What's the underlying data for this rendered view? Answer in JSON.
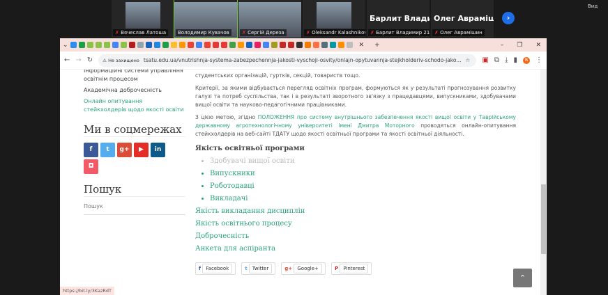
{
  "zoom": {
    "view_label": "Вид",
    "participants": [
      {
        "name": "Вячеслав Латоша",
        "muted": true,
        "video": true
      },
      {
        "name": "Володимир Кувачов",
        "muted": false,
        "video": true,
        "active": true
      },
      {
        "name": "Сергій Дереза",
        "muted": true,
        "video": true
      },
      {
        "name": "Oleksandr Kalashnikov",
        "muted": true,
        "video": true
      },
      {
        "name": "Барлит Владимир 21...",
        "title": "Барлит Владим...",
        "muted": true,
        "video": false
      },
      {
        "name": "Олег Аврамішин",
        "title": "Олег Аврамішин",
        "muted": true,
        "video": false
      }
    ]
  },
  "browser": {
    "tab_favicon_colors": [
      "#2d8cf0",
      "#1e9e4a",
      "#8bc34a",
      "#8bc34a",
      "#8bc34a",
      "#4285f4",
      "#8bc34a",
      "#b71c1c",
      "#90a4ae",
      "#1565c0",
      "#1e88e5",
      "#1e9e4a",
      "#fbc02d",
      "#ff9800",
      "#ea4335",
      "#4285f4",
      "#ea4335",
      "#e53935",
      "#e53935",
      "#43a047",
      "#ff9800",
      "#1565c0",
      "#e91e63",
      "#4285f4",
      "#9e9d24",
      "#c62828",
      "#c62828",
      "#333333",
      "#f57c00",
      "#ff7043",
      "#546e7a",
      "#0097a7",
      "#ff8f00",
      "#bdbdbd"
    ],
    "security_label": "Не захищено",
    "url": "tsatu.edu.ua/vnutrishnja-systema-zabezpechennja-jakosti-vyschoji-osvity/onlajn-opytuvannja-stejkholderiv-schodo-jako...",
    "profile_initial": "В",
    "status_url": "https://bit.ly/3KazRdT"
  },
  "sidebar": {
    "items": [
      "Інформаційні системи управління освітнім процесом",
      "Академічна доброчесність",
      "Онлайн опитування стейкхолдерів щодо якості освіти"
    ],
    "social_heading": "Ми в соцмережах",
    "social": [
      {
        "icon": "f",
        "color": "#3b5998"
      },
      {
        "icon": "t",
        "color": "#55acee"
      },
      {
        "icon": "g+",
        "color": "#dd4b39"
      },
      {
        "icon": "▶",
        "color": "#e52d27"
      },
      {
        "icon": "in",
        "color": "#0e5a8a"
      },
      {
        "icon": "◘",
        "color": "#f25a67"
      }
    ],
    "search_heading": "Пошук",
    "search_placeholder": "Пошук"
  },
  "main": {
    "p0": "студентських організацій, гуртків, секцій, товариств тощо.",
    "p1": "Критерії, за якими відбувається перегляд освітніх програм, формуються як у результаті прогнозування розвитку галузі та потреб суспільства, так і в результаті зворотного зв'язку з працедавцями, випускниками, здобувачами вищої освіти та науково-педагогічними працівниками.",
    "p2_pre": "З цією метою, згідно ",
    "p2_link": "ПОЛОЖЕННЯ про систему внутрішнього забезпечення якості вищої освіти у Таврійському державному агротехнологічному університеті імені Дмитра Моторного",
    "p2_post": " проводяться онлайн-опитування стейкхолдерів на веб-сайті ТДАТУ щодо якості освітньої програми та якості освітньої діяльності.",
    "section": "Якість освітньої програми",
    "sub": [
      "Здобувачі вищої освіти",
      "Випускники",
      "Роботодавці",
      "Викладачі"
    ],
    "links": [
      "Якість викладання дисциплін",
      "Якість освітнього процесу",
      "Доброчесність",
      "Анкета для аспіранта"
    ],
    "share": [
      "Facebook",
      "Twitter",
      "Google+",
      "Pinterest"
    ]
  }
}
